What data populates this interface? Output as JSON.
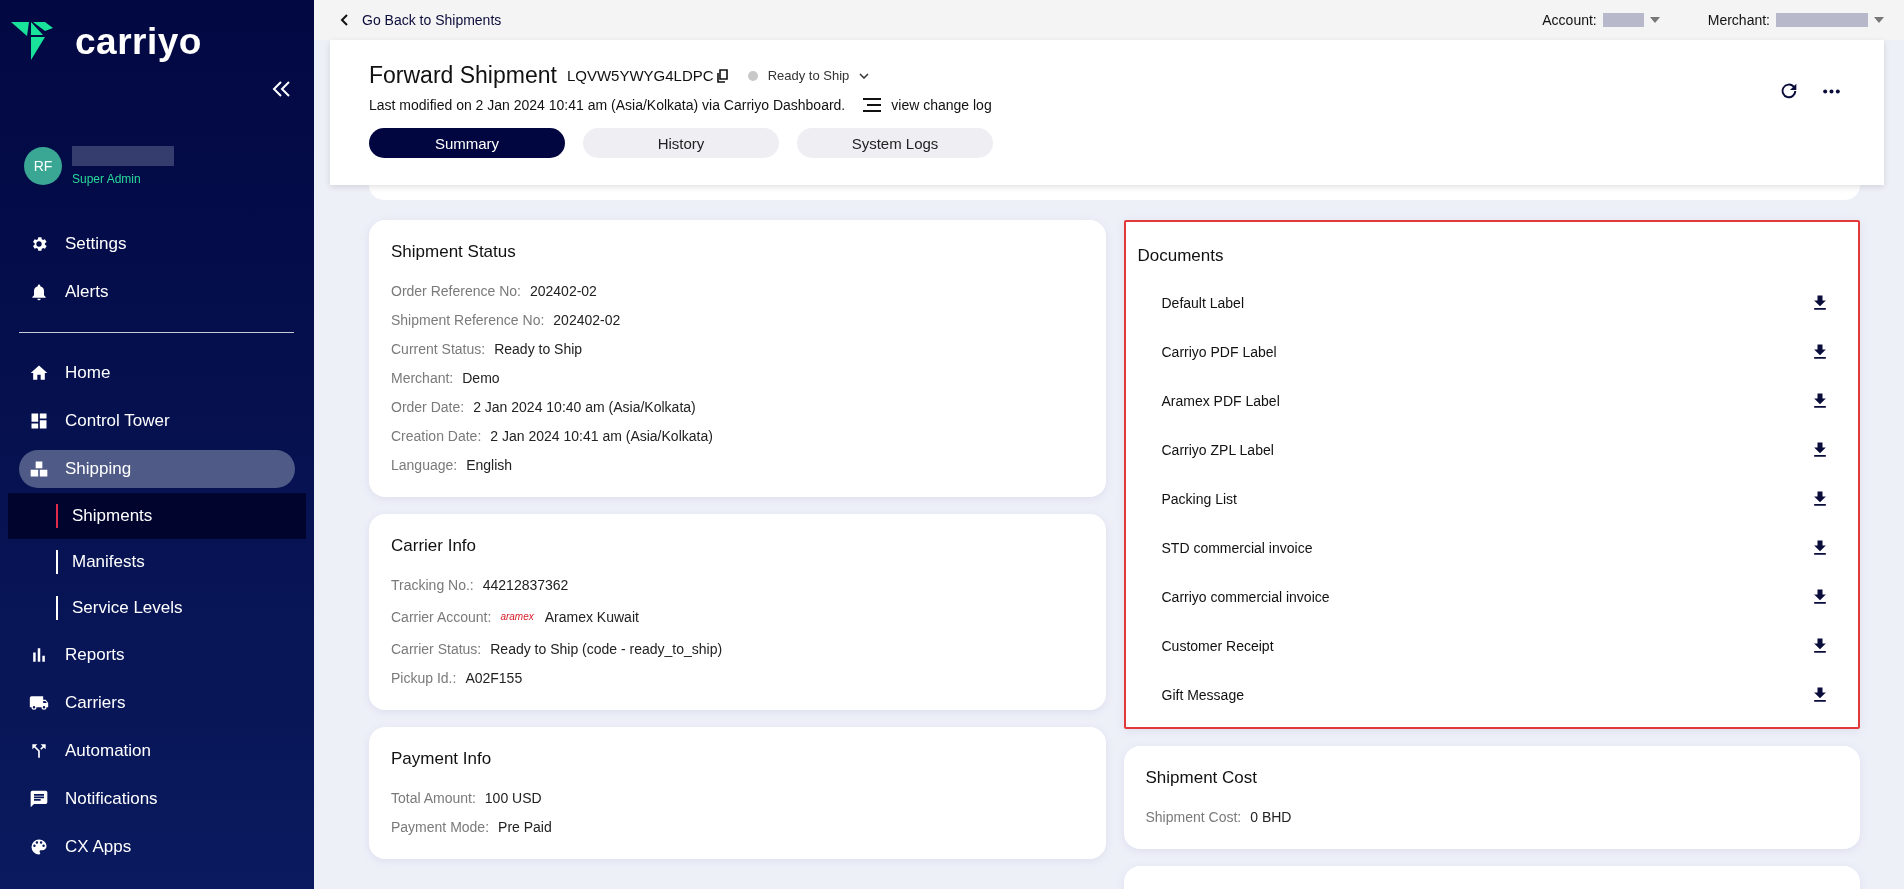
{
  "sidebar": {
    "brand": "carriyo",
    "user": {
      "initials": "RF",
      "role": "Super Admin"
    },
    "top_items": [
      {
        "label": "Settings"
      },
      {
        "label": "Alerts"
      }
    ],
    "items": [
      {
        "label": "Home",
        "selected": false
      },
      {
        "label": "Control Tower",
        "selected": false
      },
      {
        "label": "Shipping",
        "selected": true,
        "children": [
          {
            "label": "Shipments",
            "selected": true
          },
          {
            "label": "Manifests",
            "selected": false
          },
          {
            "label": "Service Levels",
            "selected": false
          }
        ]
      },
      {
        "label": "Reports",
        "selected": false
      },
      {
        "label": "Carriers",
        "selected": false
      },
      {
        "label": "Automation",
        "selected": false
      },
      {
        "label": "Notifications",
        "selected": false
      },
      {
        "label": "CX Apps",
        "selected": false
      }
    ]
  },
  "top_bar": {
    "back_link": "Go Back to Shipments",
    "account_label": "Account:",
    "merchant_label": "Merchant:"
  },
  "header": {
    "title": "Forward Shipment",
    "shipment_id": "LQVW5YWYG4LDPC",
    "status": "Ready to Ship",
    "modified": "Last modified on 2 Jan 2024 10:41 am (Asia/Kolkata) via Carriyo Dashboard.",
    "change_log_link": "view change log",
    "tabs": [
      {
        "label": "Summary",
        "selected": true
      },
      {
        "label": "History",
        "selected": false
      },
      {
        "label": "System Logs",
        "selected": false
      }
    ]
  },
  "shipment_status": {
    "title": "Shipment Status",
    "fields": [
      {
        "label": "Order Reference No:",
        "value": "202402-02"
      },
      {
        "label": "Shipment Reference No:",
        "value": "202402-02"
      },
      {
        "label": "Current Status:",
        "value": "Ready to Ship"
      },
      {
        "label": "Merchant:",
        "value": "Demo"
      },
      {
        "label": "Order Date:",
        "value": "2 Jan 2024 10:40 am (Asia/Kolkata)"
      },
      {
        "label": "Creation Date:",
        "value": "2 Jan 2024 10:41 am (Asia/Kolkata)"
      },
      {
        "label": "Language:",
        "value": "English"
      }
    ]
  },
  "carrier_info": {
    "title": "Carrier Info",
    "fields": [
      {
        "label": "Tracking No.:",
        "value": "44212837362"
      },
      {
        "label": "Carrier Account:",
        "logo": "aramex",
        "value": "Aramex Kuwait"
      },
      {
        "label": "Carrier Status:",
        "value": "Ready to Ship (code - ready_to_ship)"
      },
      {
        "label": "Pickup Id.:",
        "value": "A02F155"
      }
    ]
  },
  "payment_info": {
    "title": "Payment Info",
    "fields": [
      {
        "label": "Total Amount:",
        "value": "100 USD"
      },
      {
        "label": "Payment Mode:",
        "value": "Pre Paid"
      }
    ]
  },
  "documents": {
    "title": "Documents",
    "items": [
      "Default Label",
      "Carriyo PDF Label",
      "Aramex PDF Label",
      "Carriyo ZPL Label",
      "Packing List",
      "STD commercial invoice",
      "Carriyo commercial invoice",
      "Customer Receipt",
      "Gift Message"
    ]
  },
  "shipment_cost": {
    "title": "Shipment Cost",
    "fields": [
      {
        "label": "Shipment Cost:",
        "value": "0 BHD"
      }
    ]
  }
}
